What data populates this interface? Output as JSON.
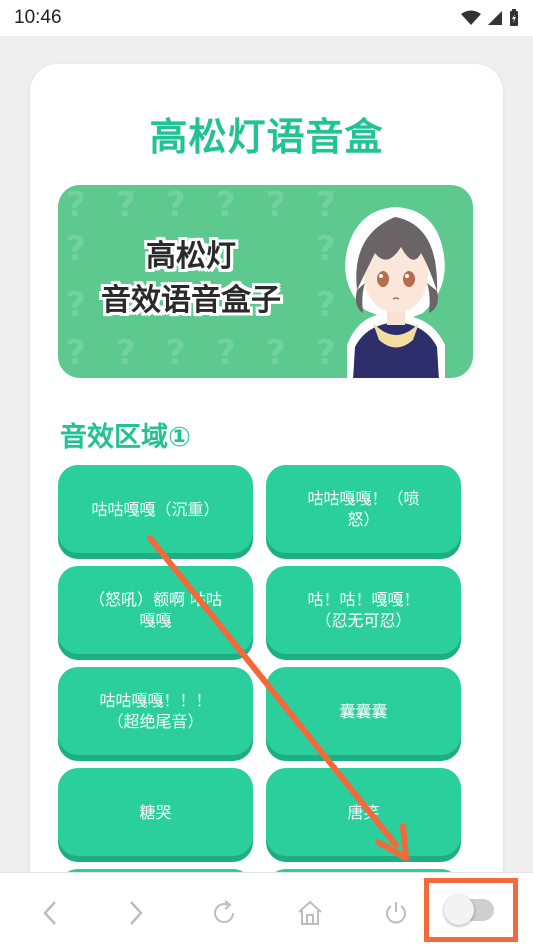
{
  "status_bar": {
    "time": "10:46"
  },
  "page": {
    "title": "高松灯语音盒"
  },
  "banner": {
    "line1": "高松灯",
    "line2": "音效语音盒子"
  },
  "section": {
    "title": "音效区域①"
  },
  "sounds": [
    "咕咕嘎嘎（沉重）",
    "咕咕嘎嘎！（喷\n怒）",
    "（怒吼）额啊 咕咕\n嘎嘎",
    "咕！咕！嘎嘎！\n（忍无可忍）",
    "咕咕嘎嘎！！！\n（超绝尾音）",
    "囊囊囊",
    "糖哭",
    "唐笑"
  ],
  "bottom_nav": {
    "icons": [
      "back-icon",
      "forward-icon",
      "refresh-icon",
      "home-icon",
      "power-icon",
      "toggle-switch"
    ]
  },
  "colors": {
    "accent": "#21c394",
    "button": "#2acf9c",
    "banner": "#5dc98e",
    "highlight": "#f26a3c"
  }
}
